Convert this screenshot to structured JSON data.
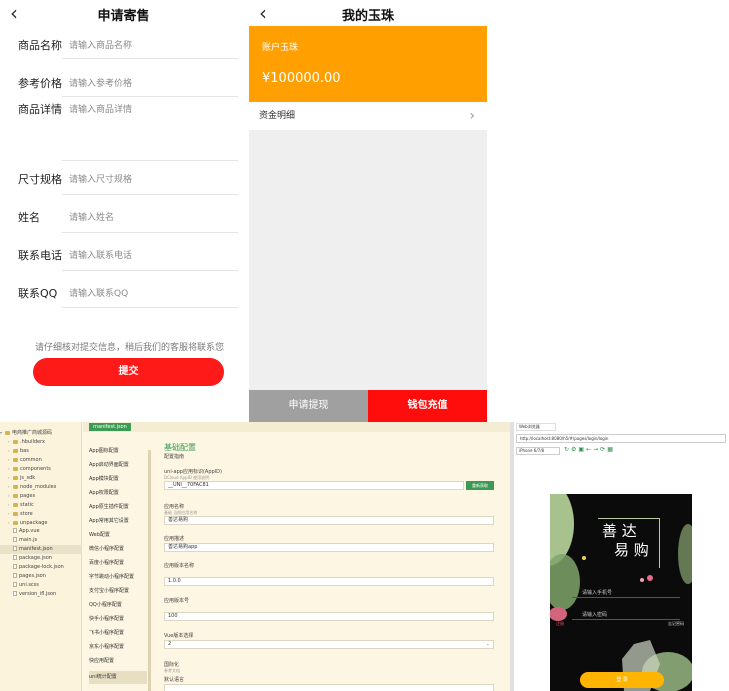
{
  "consign": {
    "back_icon": "chevron-left-icon",
    "title": "申请寄售",
    "fields": [
      {
        "label": "商品名称",
        "placeholder": "请输入商品名称"
      },
      {
        "label": "参考价格",
        "placeholder": "请输入参考价格"
      },
      {
        "label": "商品详情",
        "placeholder": "请输入商品详情"
      },
      {
        "label": "尺寸规格",
        "placeholder": "请输入尺寸规格"
      },
      {
        "label": "姓名",
        "placeholder": "请输入姓名"
      },
      {
        "label": "联系电话",
        "placeholder": "请输入联系电话"
      },
      {
        "label": "联系QQ",
        "placeholder": "请输入联系QQ"
      }
    ],
    "notice": "请仔细核对提交信息，稍后我们的客服将联系您",
    "submit": "提交",
    "submit_color": "#ff1a1a"
  },
  "wallet": {
    "back_icon": "chevron-left-icon",
    "title": "我的玉珠",
    "account_label": "账户玉珠",
    "balance": "¥100000.00",
    "accent_color": "#ffa000",
    "fund_detail": "资金明细",
    "withdraw": "申请提现",
    "recharge": "钱包充值",
    "recharge_color": "#ff0d0d"
  },
  "ide": {
    "root": "电商推广商城源码",
    "tree": [
      ".hbuilderx",
      "bas",
      "common",
      "components",
      "js_sdk",
      "node_modules",
      "pages",
      "static",
      "store",
      "unpackage",
      "App.vue",
      "main.js",
      "manifest.json",
      "package.json",
      "package-lock.json",
      "pages.json",
      "uni.scss",
      "version_ifl.json"
    ],
    "tab": "manifest.json",
    "config_nav": [
      "App图标配置",
      "App启动界面配置",
      "App模块配置",
      "App权限配置",
      "App原生插件配置",
      "App常用其它设置",
      "Web配置",
      "微信小程序配置",
      "百度小程序配置",
      "字节跳动小程序配置",
      "支付宝小程序配置",
      "QQ小程序配置",
      "快手小程序配置",
      "飞书小程序配置",
      "京东小程序配置",
      "快应用配置",
      "uni统计配置"
    ],
    "section_title": "基础配置",
    "section_link": "配置指南",
    "appid_label": "uni-app应用标识(AppID)",
    "appid_link": "DCloud AppID 使用说明",
    "appid_value": "__UNI__70FAC81",
    "appid_button": "重新获取",
    "name_label": "应用名称",
    "name_hint": "基础 当前应用名称",
    "name_value": "善达易购",
    "desc_label": "应用描述",
    "desc_value": "善达易购app",
    "version_label": "应用版本名称",
    "version_value": "1.0.0",
    "code_label": "应用版本号",
    "code_value": "100",
    "vue_label": "Vue版本选择",
    "vue_value": "2",
    "i18n_label": "国际化",
    "i18n_link": "参考文档",
    "locale_label": "默认语言"
  },
  "browser": {
    "tab": "Web浏览器",
    "url": "http://localhost:8080/h5/#/pages/login/login",
    "device": "iPhone 6/7/8",
    "app_title_1": "善 达",
    "app_title_2": "易 购",
    "phone_placeholder": "请输入手机号",
    "password_placeholder": "请输入密码",
    "register": "注册",
    "forgot": "忘记密码",
    "login": "登 录",
    "login_color": "#ffb400"
  }
}
